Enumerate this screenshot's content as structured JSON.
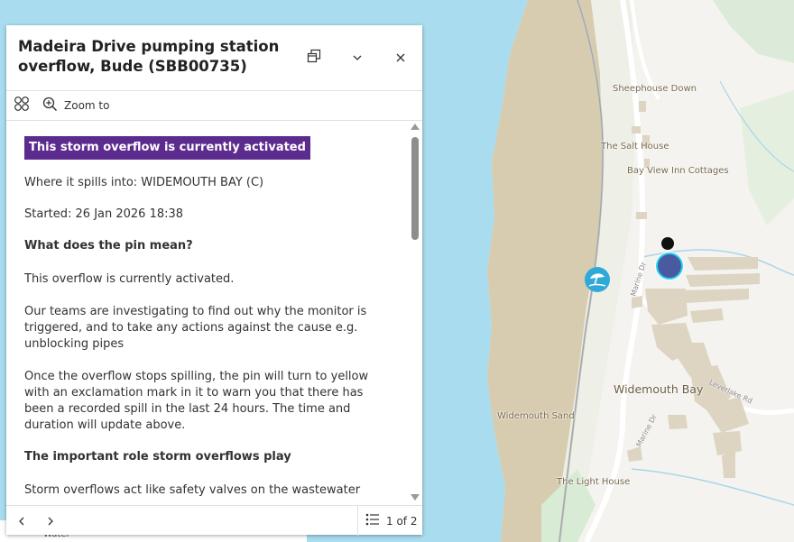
{
  "map": {
    "places": [
      {
        "id": "sheephouse-down",
        "label": "Sheephouse Down"
      },
      {
        "id": "the-salt-house",
        "label": "The Salt House"
      },
      {
        "id": "bay-view-inn",
        "label": "Bay View Inn Cottages"
      },
      {
        "id": "widemouth-bay",
        "label": "Widemouth Bay"
      },
      {
        "id": "widemouth-sand",
        "label": "Widemouth Sand"
      },
      {
        "id": "the-light-house",
        "label": "The Light House"
      }
    ],
    "roads": [
      {
        "id": "marine-dr-1",
        "label": "Marine Dr"
      },
      {
        "id": "marine-dr-2",
        "label": "Marine Dr"
      },
      {
        "id": "leverlake-rd",
        "label": "Leverlake Rd"
      }
    ],
    "beach_icon": "beach-umbrella-icon",
    "overflow_marker_color": "#4a5aa0",
    "legend_peek": "Water"
  },
  "popup": {
    "title": "Madeira Drive pumping station overflow, Bude (SBB00735)",
    "dock_icon": "dock-icon",
    "collapse_icon": "chevron-down-icon",
    "close_icon": "close-icon",
    "toolbar": {
      "select_features_icon": "select-features-icon",
      "zoom_icon": "zoom-in-icon",
      "zoom_label": "Zoom to"
    },
    "content": {
      "status_badge": "This storm overflow is currently activated",
      "spills_into": "Where it spills into: WIDEMOUTH BAY (C)",
      "started": "Started: 26 Jan 2026 18:38",
      "pin_heading": "What does the pin mean?",
      "pin_p1": "This overflow is currently activated.",
      "pin_p2": "Our teams are investigating to find out why the monitor is triggered, and to take any actions against the cause e.g. unblocking pipes",
      "pin_p3": "Once the overflow stops spilling, the pin will turn to yellow with an exclamation mark in it to warn you that there has been a recorded spill in the last 24 hours. The time and duration will update above.",
      "role_heading": "The important role storm overflows play",
      "role_p1": "Storm overflows act like safety valves on the wastewater"
    },
    "footer": {
      "prev_icon": "chevron-left-icon",
      "next_icon": "chevron-right-icon",
      "list_icon": "feature-list-icon",
      "pager": "1 of 2"
    },
    "colors": {
      "badge": "#5b2b8e"
    }
  }
}
